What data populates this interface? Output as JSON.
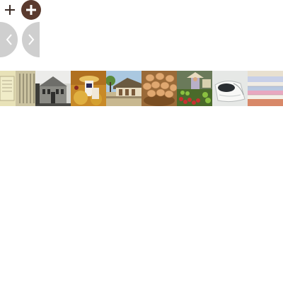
{
  "controls": {
    "plus_icon": "plus-icon",
    "plus_circle_icon": "plus-circle-icon",
    "prev_icon": "chevron-left-icon",
    "next_icon": "chevron-right-icon"
  },
  "colors": {
    "circle_button": "#5a3a2e",
    "arrow_button": "#cfcfcf",
    "icon_dark": "#3a2a24",
    "icon_light": "#ffffff"
  },
  "thumbnails": [
    {
      "subject": "old-document"
    },
    {
      "subject": "historic-building"
    },
    {
      "subject": "traditional-dancers"
    },
    {
      "subject": "traditional-house"
    },
    {
      "subject": "potatoes-basket"
    },
    {
      "subject": "market-vendor"
    },
    {
      "subject": "white-fabric"
    },
    {
      "subject": "folded-cloths"
    }
  ]
}
